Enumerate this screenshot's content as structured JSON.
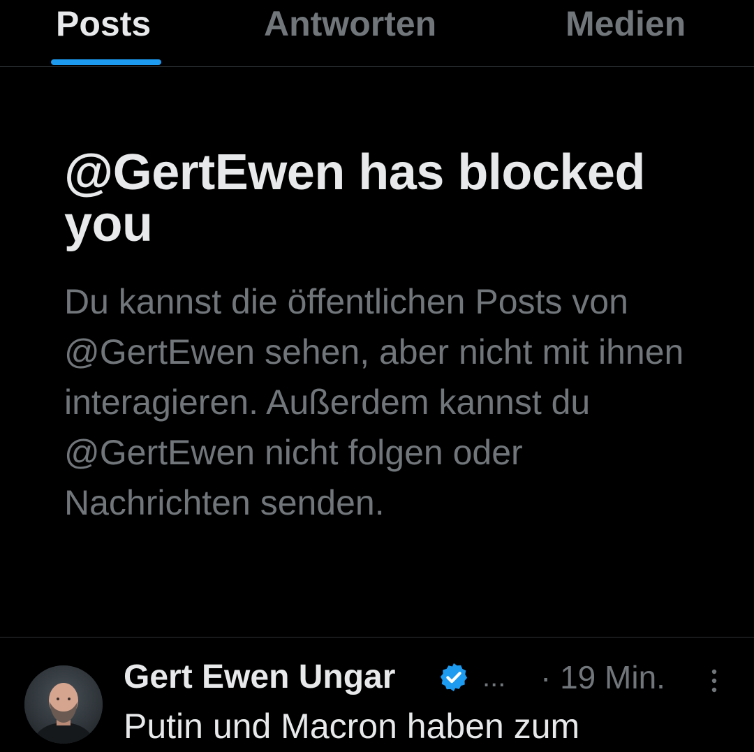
{
  "tabs": [
    {
      "label": "Posts",
      "active": true
    },
    {
      "label": "Antworten",
      "active": false
    },
    {
      "label": "Medien",
      "active": false
    }
  ],
  "notice": {
    "title": "@GertEwen has blocked you",
    "body": "Du kannst die öffentlichen Posts von @GertEwen sehen, aber nicht mit ihnen interagieren. Außerdem kannst du @GertEwen nicht folgen oder Nachrichten senden."
  },
  "post": {
    "author_name": "Gert Ewen Ungar",
    "verified_icon": "verified-badge-icon",
    "handle_truncated": "...",
    "timestamp": "· 19 Min.",
    "more_icon": "more-vertical-icon",
    "text": "Putin und Macron haben zum"
  },
  "colors": {
    "background": "#000000",
    "primary_text": "#e7e9ea",
    "secondary_text": "#71767b",
    "accent": "#1d9bf0",
    "divider": "#2f3336"
  }
}
